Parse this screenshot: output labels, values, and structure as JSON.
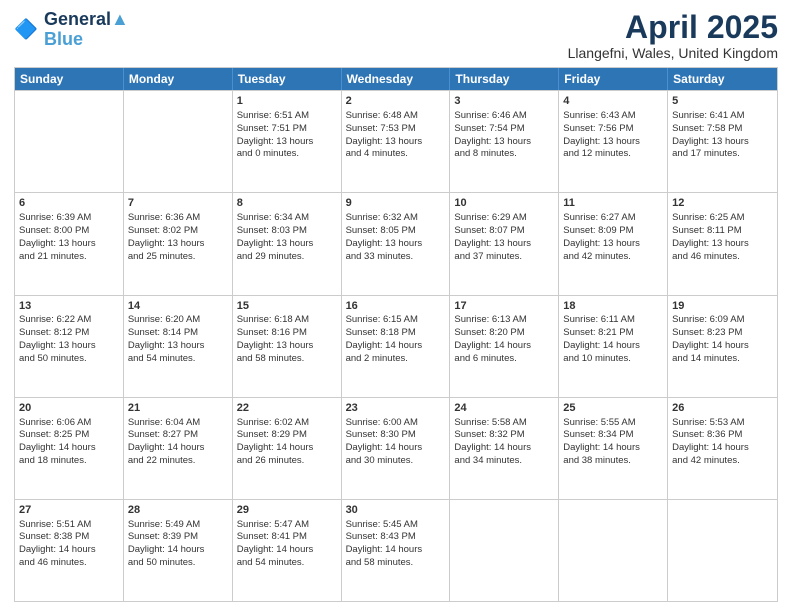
{
  "header": {
    "logo_line1": "General",
    "logo_line2": "Blue",
    "month": "April 2025",
    "location": "Llangefni, Wales, United Kingdom"
  },
  "weekdays": [
    "Sunday",
    "Monday",
    "Tuesday",
    "Wednesday",
    "Thursday",
    "Friday",
    "Saturday"
  ],
  "weeks": [
    [
      {
        "day": "",
        "text": ""
      },
      {
        "day": "",
        "text": ""
      },
      {
        "day": "1",
        "text": "Sunrise: 6:51 AM\nSunset: 7:51 PM\nDaylight: 13 hours\nand 0 minutes."
      },
      {
        "day": "2",
        "text": "Sunrise: 6:48 AM\nSunset: 7:53 PM\nDaylight: 13 hours\nand 4 minutes."
      },
      {
        "day": "3",
        "text": "Sunrise: 6:46 AM\nSunset: 7:54 PM\nDaylight: 13 hours\nand 8 minutes."
      },
      {
        "day": "4",
        "text": "Sunrise: 6:43 AM\nSunset: 7:56 PM\nDaylight: 13 hours\nand 12 minutes."
      },
      {
        "day": "5",
        "text": "Sunrise: 6:41 AM\nSunset: 7:58 PM\nDaylight: 13 hours\nand 17 minutes."
      }
    ],
    [
      {
        "day": "6",
        "text": "Sunrise: 6:39 AM\nSunset: 8:00 PM\nDaylight: 13 hours\nand 21 minutes."
      },
      {
        "day": "7",
        "text": "Sunrise: 6:36 AM\nSunset: 8:02 PM\nDaylight: 13 hours\nand 25 minutes."
      },
      {
        "day": "8",
        "text": "Sunrise: 6:34 AM\nSunset: 8:03 PM\nDaylight: 13 hours\nand 29 minutes."
      },
      {
        "day": "9",
        "text": "Sunrise: 6:32 AM\nSunset: 8:05 PM\nDaylight: 13 hours\nand 33 minutes."
      },
      {
        "day": "10",
        "text": "Sunrise: 6:29 AM\nSunset: 8:07 PM\nDaylight: 13 hours\nand 37 minutes."
      },
      {
        "day": "11",
        "text": "Sunrise: 6:27 AM\nSunset: 8:09 PM\nDaylight: 13 hours\nand 42 minutes."
      },
      {
        "day": "12",
        "text": "Sunrise: 6:25 AM\nSunset: 8:11 PM\nDaylight: 13 hours\nand 46 minutes."
      }
    ],
    [
      {
        "day": "13",
        "text": "Sunrise: 6:22 AM\nSunset: 8:12 PM\nDaylight: 13 hours\nand 50 minutes."
      },
      {
        "day": "14",
        "text": "Sunrise: 6:20 AM\nSunset: 8:14 PM\nDaylight: 13 hours\nand 54 minutes."
      },
      {
        "day": "15",
        "text": "Sunrise: 6:18 AM\nSunset: 8:16 PM\nDaylight: 13 hours\nand 58 minutes."
      },
      {
        "day": "16",
        "text": "Sunrise: 6:15 AM\nSunset: 8:18 PM\nDaylight: 14 hours\nand 2 minutes."
      },
      {
        "day": "17",
        "text": "Sunrise: 6:13 AM\nSunset: 8:20 PM\nDaylight: 14 hours\nand 6 minutes."
      },
      {
        "day": "18",
        "text": "Sunrise: 6:11 AM\nSunset: 8:21 PM\nDaylight: 14 hours\nand 10 minutes."
      },
      {
        "day": "19",
        "text": "Sunrise: 6:09 AM\nSunset: 8:23 PM\nDaylight: 14 hours\nand 14 minutes."
      }
    ],
    [
      {
        "day": "20",
        "text": "Sunrise: 6:06 AM\nSunset: 8:25 PM\nDaylight: 14 hours\nand 18 minutes."
      },
      {
        "day": "21",
        "text": "Sunrise: 6:04 AM\nSunset: 8:27 PM\nDaylight: 14 hours\nand 22 minutes."
      },
      {
        "day": "22",
        "text": "Sunrise: 6:02 AM\nSunset: 8:29 PM\nDaylight: 14 hours\nand 26 minutes."
      },
      {
        "day": "23",
        "text": "Sunrise: 6:00 AM\nSunset: 8:30 PM\nDaylight: 14 hours\nand 30 minutes."
      },
      {
        "day": "24",
        "text": "Sunrise: 5:58 AM\nSunset: 8:32 PM\nDaylight: 14 hours\nand 34 minutes."
      },
      {
        "day": "25",
        "text": "Sunrise: 5:55 AM\nSunset: 8:34 PM\nDaylight: 14 hours\nand 38 minutes."
      },
      {
        "day": "26",
        "text": "Sunrise: 5:53 AM\nSunset: 8:36 PM\nDaylight: 14 hours\nand 42 minutes."
      }
    ],
    [
      {
        "day": "27",
        "text": "Sunrise: 5:51 AM\nSunset: 8:38 PM\nDaylight: 14 hours\nand 46 minutes."
      },
      {
        "day": "28",
        "text": "Sunrise: 5:49 AM\nSunset: 8:39 PM\nDaylight: 14 hours\nand 50 minutes."
      },
      {
        "day": "29",
        "text": "Sunrise: 5:47 AM\nSunset: 8:41 PM\nDaylight: 14 hours\nand 54 minutes."
      },
      {
        "day": "30",
        "text": "Sunrise: 5:45 AM\nSunset: 8:43 PM\nDaylight: 14 hours\nand 58 minutes."
      },
      {
        "day": "",
        "text": ""
      },
      {
        "day": "",
        "text": ""
      },
      {
        "day": "",
        "text": ""
      }
    ]
  ]
}
